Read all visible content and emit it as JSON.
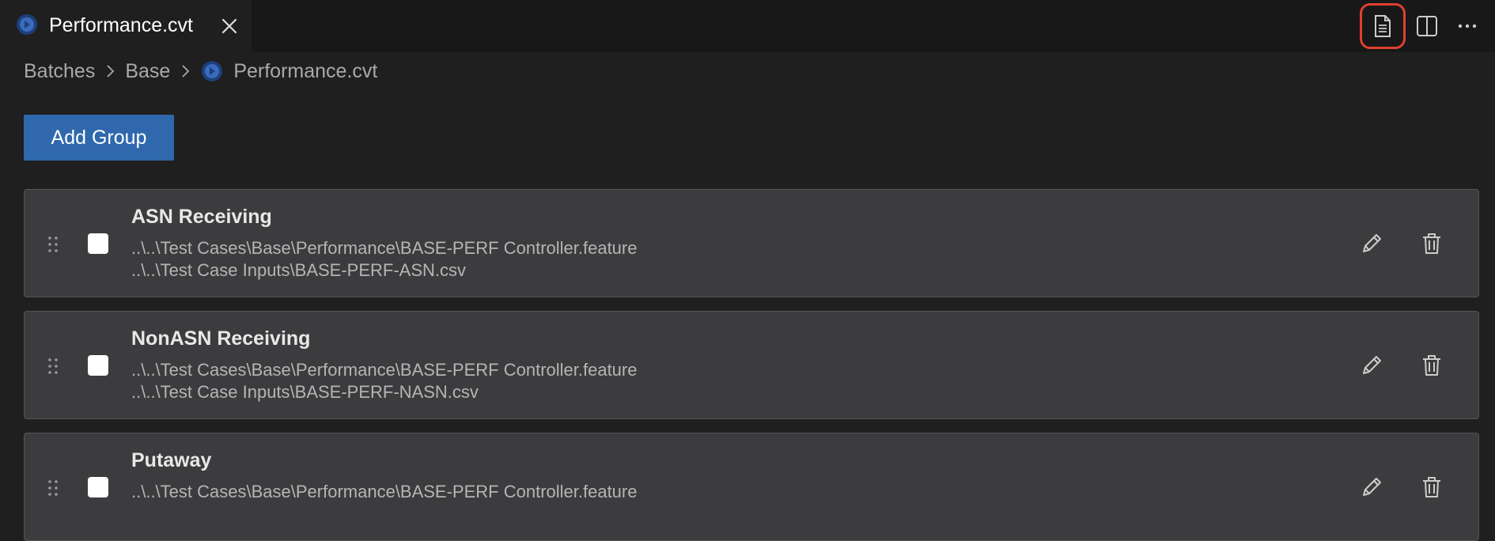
{
  "tab": {
    "title": "Performance.cvt",
    "icon": "file-type-icon",
    "close_icon": "close-icon"
  },
  "top_actions": [
    {
      "name": "open-as-text-icon",
      "highlighted": true
    },
    {
      "name": "split-editor-icon",
      "highlighted": false
    },
    {
      "name": "more-actions-icon",
      "highlighted": false
    }
  ],
  "breadcrumb": {
    "items": [
      "Batches",
      "Base"
    ],
    "file": "Performance.cvt"
  },
  "toolbar": {
    "add_group_label": "Add Group"
  },
  "groups": [
    {
      "name": "ASN Receiving",
      "feature": "..\\..\\Test Cases\\Base\\Performance\\BASE-PERF Controller.feature",
      "input": "..\\..\\Test Case Inputs\\BASE-PERF-ASN.csv",
      "checked": false
    },
    {
      "name": "NonASN Receiving",
      "feature": "..\\..\\Test Cases\\Base\\Performance\\BASE-PERF Controller.feature",
      "input": "..\\..\\Test Case Inputs\\BASE-PERF-NASN.csv",
      "checked": false
    },
    {
      "name": "Putaway",
      "feature": "..\\..\\Test Cases\\Base\\Performance\\BASE-PERF Controller.feature",
      "input": "",
      "checked": false
    }
  ],
  "colors": {
    "background": "#1f1f1f",
    "tabbar": "#181818",
    "card": "#3c3c3f",
    "accent_button": "#2f68ad",
    "highlight_ring": "#e0402f",
    "file_icon": "#3b6bbf"
  }
}
